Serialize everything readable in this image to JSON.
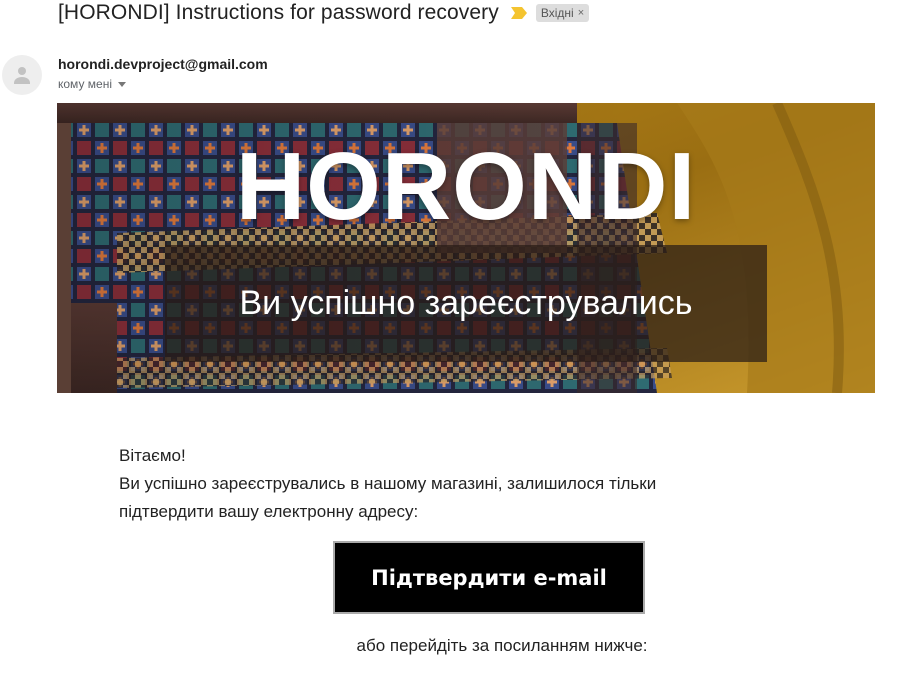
{
  "email": {
    "subject": "[HORONDI] Instructions for password recovery",
    "label": "Вхідні",
    "label_remove_glyph": "×",
    "importance_color": "#f4c430",
    "sender": "horondi.devproject@gmail.com",
    "recipient": "кому мені"
  },
  "hero": {
    "brand": "HORONDI",
    "subtitle": "Ви успішно зареєструвались"
  },
  "body": {
    "greeting": "Вітаємо!",
    "line1": "Ви успішно зареєструвались в нашому магазині, залишилося тільки",
    "line2": "підтвердити вашу електронну адресу:",
    "button_label": "Підтвердити e-mail",
    "link_hint": "або перейдіть за посиланням нижче:"
  },
  "icons": {
    "importance": "importance-marker-icon",
    "avatar": "person-icon",
    "caret": "caret-down-icon"
  }
}
